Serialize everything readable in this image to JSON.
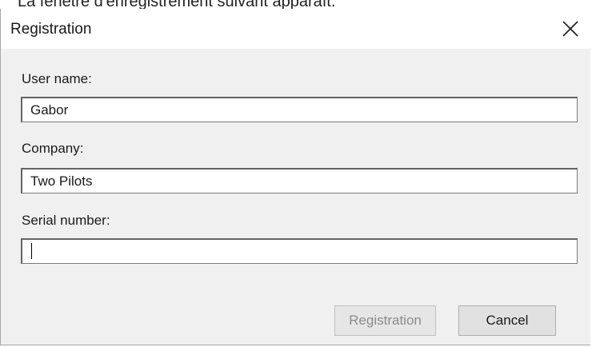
{
  "page": {
    "caption": "La fenêtre d'enregistrement suivant apparaît."
  },
  "dialog": {
    "title": "Registration",
    "close_icon": "close-icon",
    "fields": {
      "user_name": {
        "label": "User name:",
        "value": "Gabor"
      },
      "company": {
        "label": "Company:",
        "value": "Two Pilots"
      },
      "serial_number": {
        "label": "Serial number:",
        "value": ""
      }
    },
    "buttons": {
      "registration": {
        "label": "Registration",
        "enabled": false
      },
      "cancel": {
        "label": "Cancel",
        "enabled": true
      }
    }
  },
  "colors": {
    "client_background": "#f0f0f0",
    "disabled_text": "#8c8c8c"
  }
}
